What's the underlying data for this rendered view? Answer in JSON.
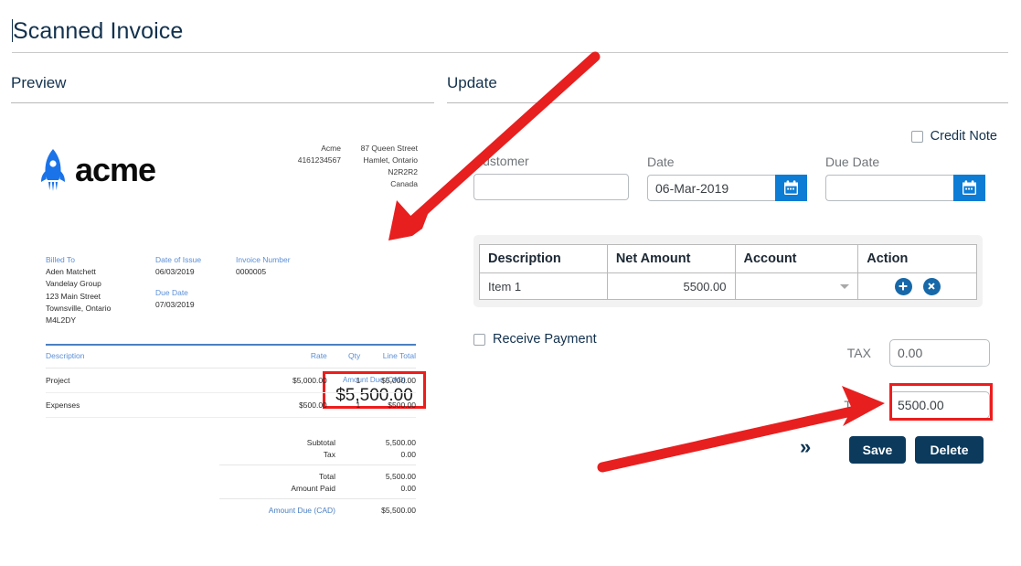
{
  "page": {
    "title": "Scanned Invoice"
  },
  "sections": {
    "preview_label": "Preview",
    "update_label": "Update"
  },
  "invoice_preview": {
    "brand": {
      "name": "acme",
      "logo_icon": "rocket-icon"
    },
    "company": {
      "name": "Acme",
      "phone": "4161234567",
      "address_lines": [
        "87 Queen Street",
        "Hamlet, Ontario",
        "N2R2R2",
        "Canada"
      ]
    },
    "billed_to": {
      "label": "Billed To",
      "lines": [
        "Aden Matchett",
        "Vandelay Group",
        "123 Main Street",
        "Townsville, Ontario",
        "M4L2DY"
      ]
    },
    "date_of_issue": {
      "label": "Date of Issue",
      "value": "06/03/2019"
    },
    "due_date": {
      "label": "Due Date",
      "value": "07/03/2019"
    },
    "invoice_number": {
      "label": "Invoice Number",
      "value": "0000005"
    },
    "amount_due_highlight": {
      "label": "Amount Due (CAD)",
      "value": "$5,500.00",
      "highlight_color": "#ee1c1c"
    },
    "lines_table": {
      "columns": [
        "Description",
        "Rate",
        "Qty",
        "Line Total"
      ],
      "rows": [
        {
          "description": "Project",
          "rate": "$5,000.00",
          "qty": "1",
          "line_total": "$5,000.00"
        },
        {
          "description": "Expenses",
          "rate": "$500.00",
          "qty": "1",
          "line_total": "$500.00"
        }
      ]
    },
    "totals": [
      {
        "label": "Subtotal",
        "value": "5,500.00"
      },
      {
        "label": "Tax",
        "value": "0.00"
      },
      {
        "label": "Total",
        "value": "5,500.00"
      },
      {
        "label": "Amount Paid",
        "value": "0.00"
      },
      {
        "label": "Amount Due (CAD)",
        "value": "$5,500.00"
      }
    ]
  },
  "update_form": {
    "credit_note": {
      "label": "Credit Note",
      "checked": false
    },
    "customer": {
      "label": "Customer",
      "value": ""
    },
    "date": {
      "label": "Date",
      "value": "06-Mar-2019",
      "icon": "calendar-icon"
    },
    "due_date": {
      "label": "Due Date",
      "value": "",
      "icon": "calendar-icon"
    },
    "items_table": {
      "columns": [
        "Description",
        "Net Amount",
        "Account",
        "Action"
      ],
      "rows": [
        {
          "description": "Item 1",
          "net_amount": "5500.00",
          "account": "",
          "actions": [
            "add-icon",
            "remove-icon"
          ]
        }
      ]
    },
    "receive_payment": {
      "label": "Receive Payment",
      "checked": false
    },
    "tax": {
      "label": "TAX",
      "value": "0.00"
    },
    "total": {
      "label": "Total",
      "value": "5500.00",
      "highlight_color": "#ee1c1c"
    },
    "expand_icon": "double-chevron-right-icon",
    "save_button": "Save",
    "delete_button": "Delete"
  },
  "annotations": {
    "arrow_color": "#e81f1f",
    "arrows": [
      {
        "name": "arrow-to-amount-due",
        "from": [
          650,
          62
        ],
        "to": [
          430,
          258
        ]
      },
      {
        "name": "arrow-to-total-field",
        "from": [
          658,
          512
        ],
        "to": [
          966,
          441
        ]
      }
    ]
  }
}
